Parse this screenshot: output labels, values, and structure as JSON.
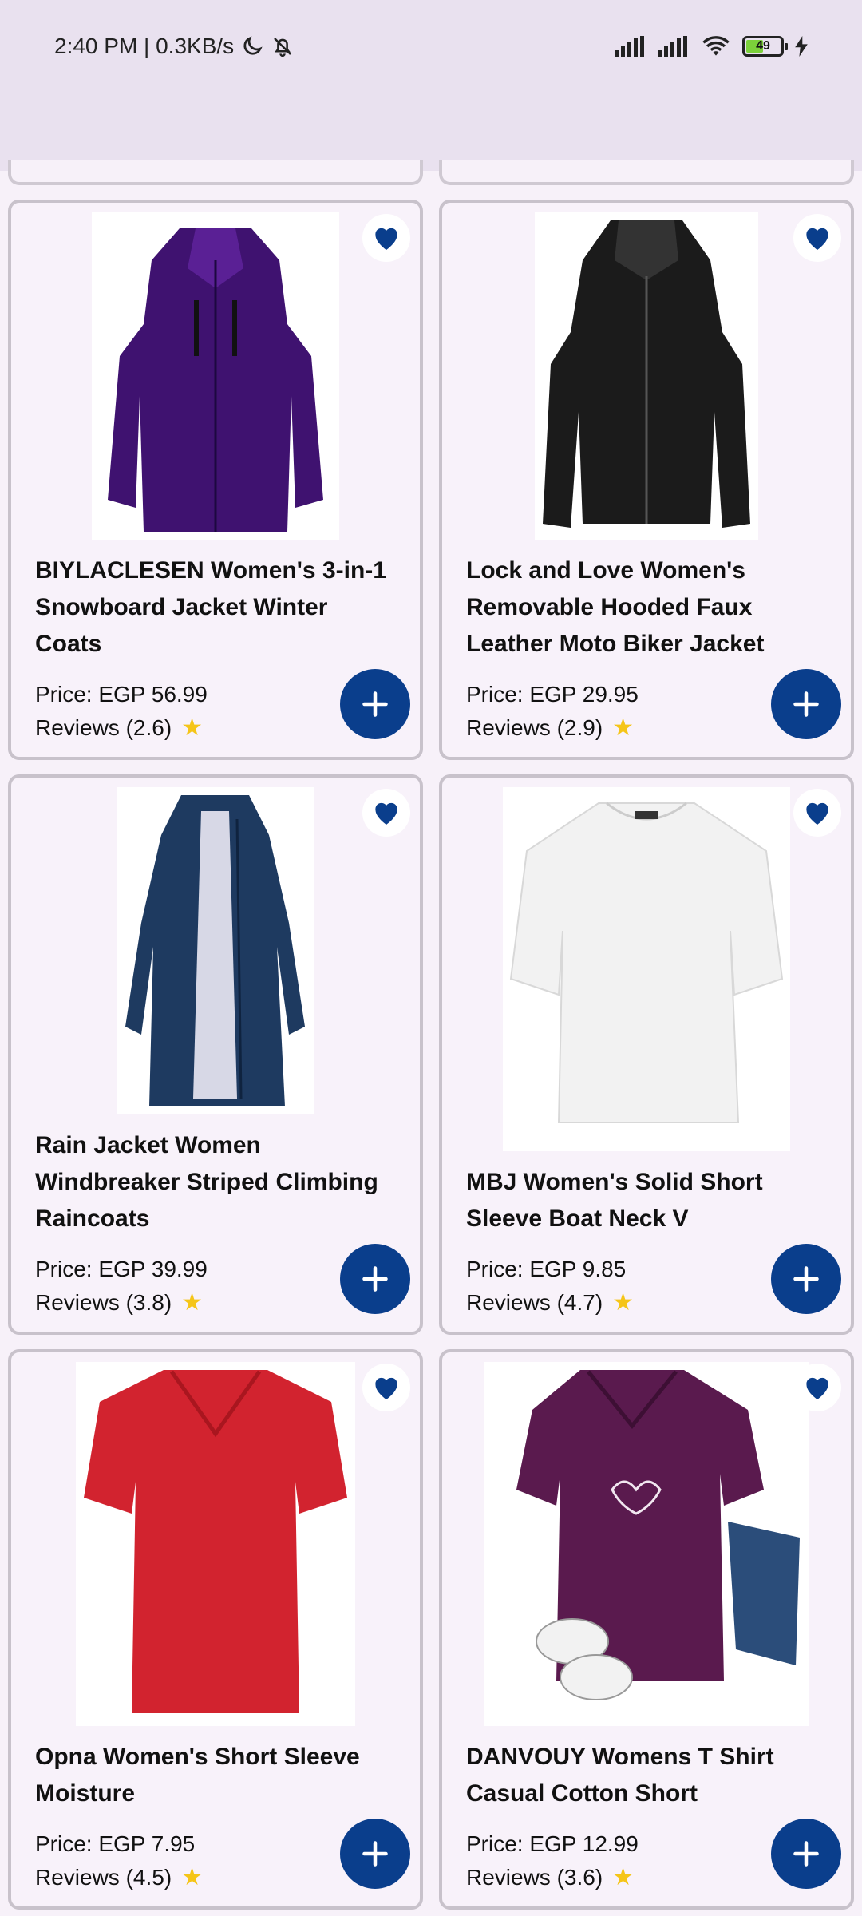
{
  "status_bar": {
    "time_speed": "2:40 PM | 0.3KB/s",
    "battery_level": "49",
    "battery_fraction": 0.49
  },
  "products": [
    {
      "title": "BIYLACLESEN Women's 3-in-1 Snowboard Jacket Winter Coats",
      "price": "Price: EGP 56.99",
      "reviews": "Reviews (2.6)"
    },
    {
      "title": "Lock and Love Women's Removable Hooded Faux Leather Moto Biker Jacket",
      "price": "Price: EGP 29.95",
      "reviews": "Reviews (2.9)"
    },
    {
      "title": "Rain Jacket Women Windbreaker Striped Climbing Raincoats",
      "price": "Price: EGP 39.99",
      "reviews": "Reviews (3.8)"
    },
    {
      "title": "MBJ Women's Solid Short Sleeve Boat Neck V",
      "price": "Price: EGP 9.85",
      "reviews": "Reviews (4.7)"
    },
    {
      "title": "Opna Women's Short Sleeve Moisture",
      "price": "Price: EGP 7.95",
      "reviews": "Reviews (4.5)"
    },
    {
      "title": "DANVOUY Womens T Shirt Casual Cotton Short",
      "price": "Price: EGP 12.99",
      "reviews": "Reviews (3.6)"
    }
  ],
  "icons": {
    "favorite": "heart-icon",
    "add": "plus-icon",
    "rating": "star-icon"
  },
  "colors": {
    "accent": "#0a3e8c",
    "star": "#f5c518",
    "background": "#f7f1f9"
  }
}
